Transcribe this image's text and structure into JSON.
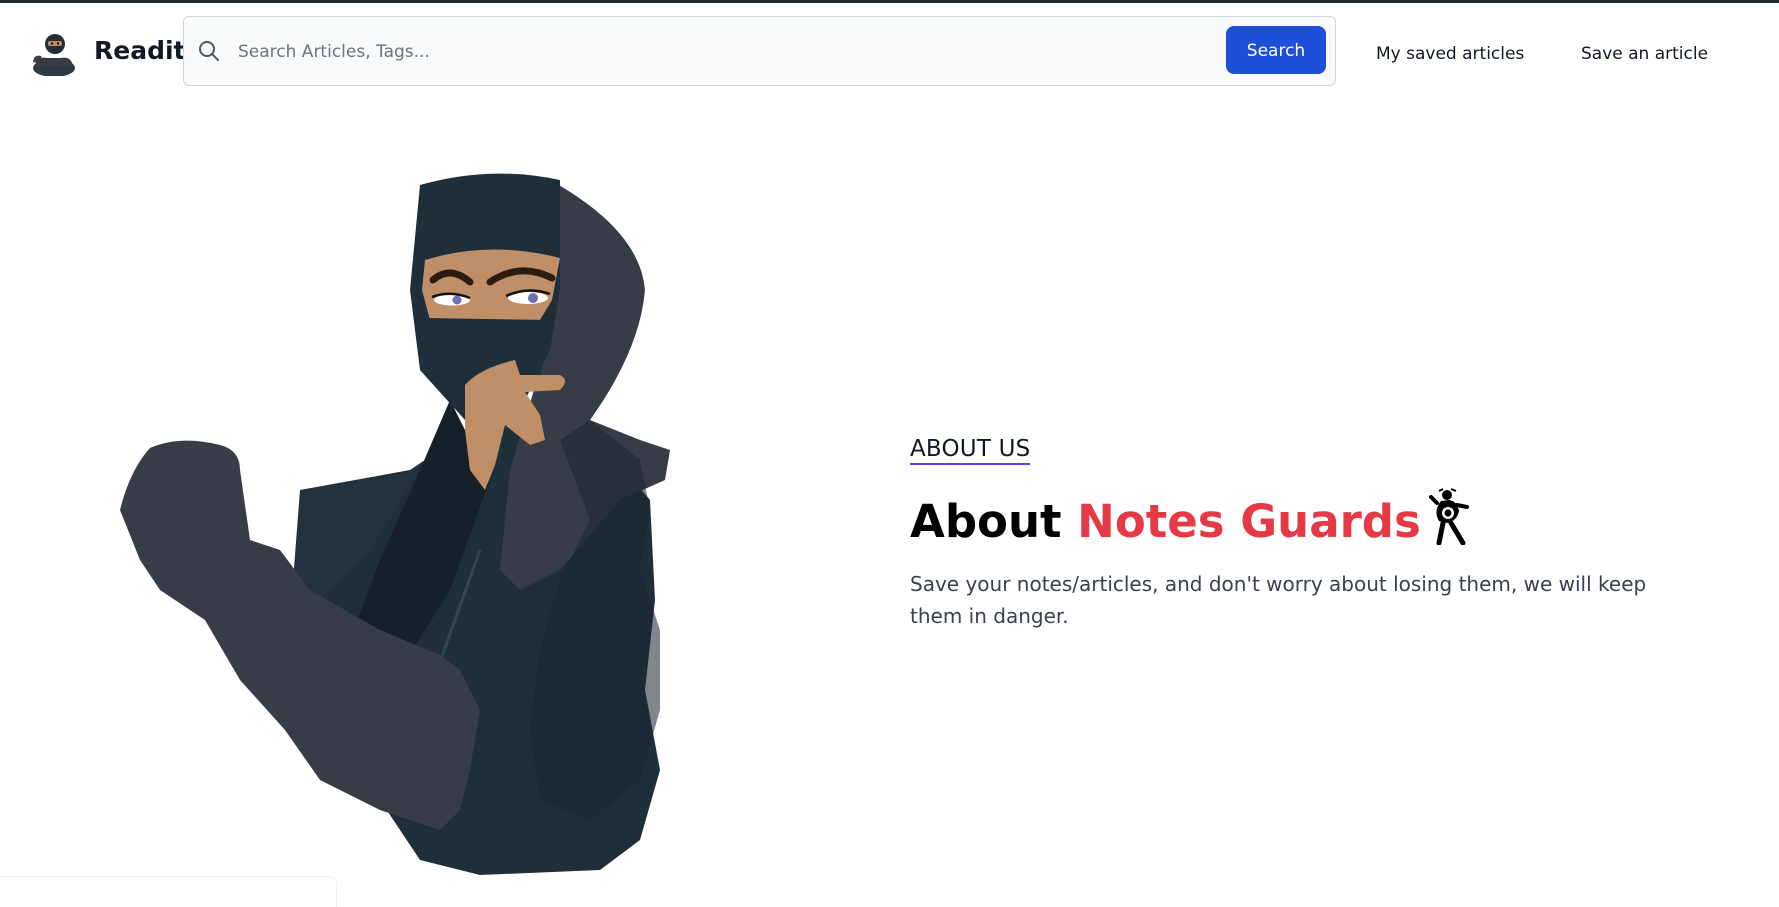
{
  "header": {
    "brand": "Readit",
    "logo_icon": "ninja-logo-icon",
    "search": {
      "placeholder": "Search Articles, Tags...",
      "value": "",
      "icon": "search-icon",
      "button_label": "Search"
    },
    "nav": {
      "saved_articles": "My saved articles",
      "save_article": "Save an article"
    }
  },
  "hero": {
    "illustration": "ninja-illustration",
    "kicker": "ABOUT US",
    "title_prefix": "About ",
    "title_accent": "Notes Guards",
    "title_icon": "ninja-icon",
    "description": "Save your notes/articles, and don't worry about losing them, we will keep them in danger."
  },
  "colors": {
    "accent_red": "#e63946",
    "primary_blue": "#1d4fd8",
    "underline_indigo": "#4f46e5",
    "ninja_dark": "#1f2f3a",
    "ninja_gray": "#383c46",
    "skin": "#c08e67"
  }
}
